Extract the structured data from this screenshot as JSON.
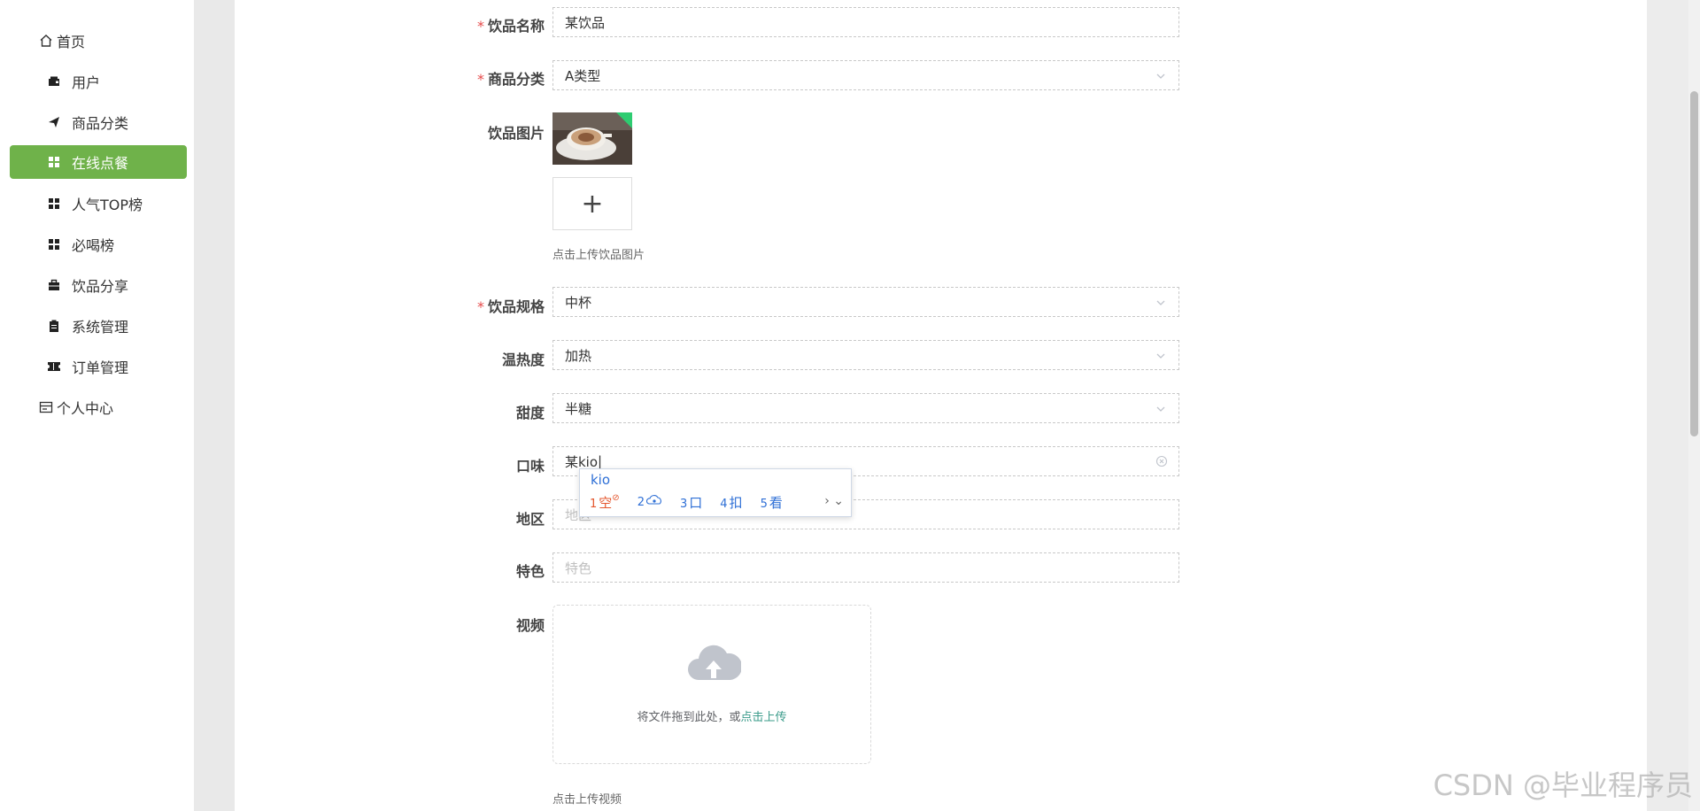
{
  "sidebar": {
    "items": [
      {
        "label": "首页",
        "icon": "home-icon"
      },
      {
        "label": "用户",
        "icon": "wallet-icon"
      },
      {
        "label": "商品分类",
        "icon": "send-icon"
      },
      {
        "label": "在线点餐",
        "icon": "grid-icon",
        "active": true
      },
      {
        "label": "人气TOP榜",
        "icon": "grid-icon"
      },
      {
        "label": "必喝榜",
        "icon": "grid-icon"
      },
      {
        "label": "饮品分享",
        "icon": "briefcase-icon"
      },
      {
        "label": "系统管理",
        "icon": "clipboard-icon"
      },
      {
        "label": "订单管理",
        "icon": "ticket-icon"
      },
      {
        "label": "个人中心",
        "icon": "card-icon"
      }
    ],
    "active_color": "#6fb24a"
  },
  "form": {
    "name": {
      "label": "饮品名称",
      "required": "*",
      "value": "某饮品"
    },
    "category": {
      "label": "商品分类",
      "required": "*",
      "value": "A类型"
    },
    "image": {
      "label": "饮品图片",
      "hint": "点击上传饮品图片",
      "add": "+"
    },
    "spec": {
      "label": "饮品规格",
      "required": "*",
      "value": "中杯"
    },
    "temperature": {
      "label": "温热度",
      "value": "加热"
    },
    "sweetness": {
      "label": "甜度",
      "value": "半糖"
    },
    "taste": {
      "label": "口味",
      "value": "某kio"
    },
    "region": {
      "label": "地区",
      "placeholder": "地区"
    },
    "feature": {
      "label": "特色",
      "placeholder": "特色"
    },
    "video": {
      "label": "视频",
      "drop_text": "将文件拖到此处，或",
      "link_text": "点击上传",
      "hint": "点击上传视频"
    }
  },
  "ime": {
    "composition": "kio",
    "candidates": [
      {
        "num": "1",
        "text": "空"
      },
      {
        "num": "2",
        "text": ""
      },
      {
        "num": "3",
        "text": "口"
      },
      {
        "num": "4",
        "text": "扣"
      },
      {
        "num": "5",
        "text": "看"
      }
    ],
    "next": "›",
    "expand": "⌄"
  },
  "watermark": "CSDN @毕业程序员"
}
